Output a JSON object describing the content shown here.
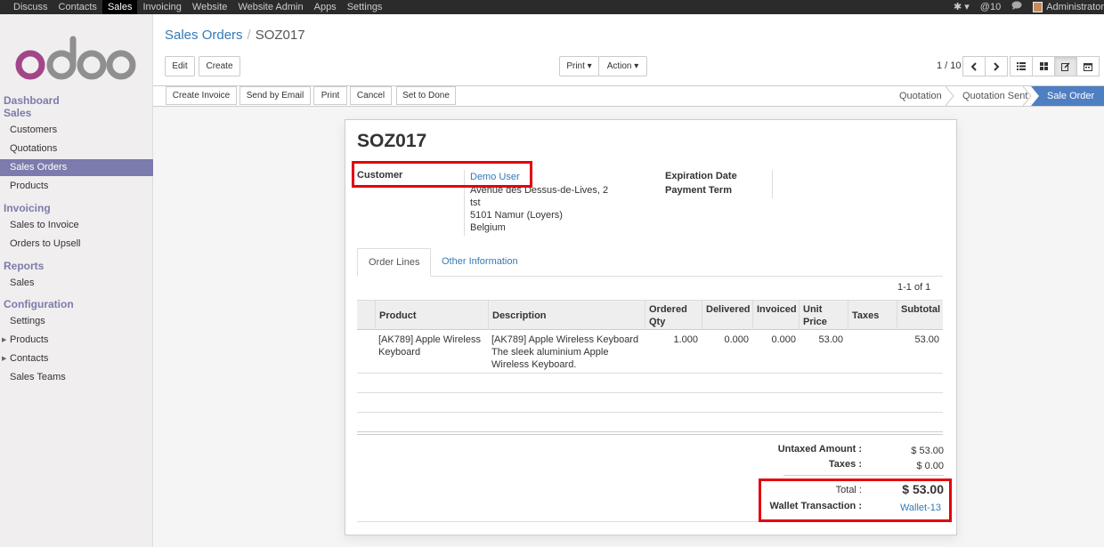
{
  "topbar": {
    "menu": [
      "Discuss",
      "Contacts",
      "Sales",
      "Invoicing",
      "Website",
      "Website Admin",
      "Apps",
      "Settings"
    ],
    "active": "Sales",
    "bug": "✱ ▾",
    "notifications": "@10",
    "chat": "💬",
    "user": "Administrator"
  },
  "sidebar": {
    "dashboard": "Dashboard",
    "sales_head": "Sales",
    "sales_items": [
      "Customers",
      "Quotations",
      "Sales Orders",
      "Products"
    ],
    "invoicing_head": "Invoicing",
    "invoicing_items": [
      "Sales to Invoice",
      "Orders to Upsell"
    ],
    "reports_head": "Reports",
    "reports_items": [
      "Sales"
    ],
    "config_head": "Configuration",
    "config_items": [
      "Settings",
      "Products",
      "Contacts",
      "Sales Teams"
    ]
  },
  "breadcrumb": {
    "parent": "Sales Orders",
    "current": "SOZ017",
    "sep": "/"
  },
  "buttons": {
    "edit": "Edit",
    "create": "Create",
    "print": "Print ▾",
    "action": "Action ▾",
    "pager": "1 / 10"
  },
  "status_buttons": [
    "Create Invoice",
    "Send by Email",
    "Print",
    "Cancel",
    "Set to Done"
  ],
  "stages": [
    "Quotation",
    "Quotation Sent",
    "Sale Order"
  ],
  "form": {
    "name": "SOZ017",
    "customer_label": "Customer",
    "customer": "Demo User",
    "address": [
      "Avenue des Dessus-de-Lives, 2",
      "tst",
      "5101 Namur (Loyers)",
      "Belgium"
    ],
    "expiration_label": "Expiration Date",
    "payment_term_label": "Payment Term"
  },
  "tabs": [
    "Order Lines",
    "Other Information"
  ],
  "table": {
    "pager": "1-1 of 1",
    "headers": [
      "Product",
      "Description",
      "Ordered Qty",
      "Delivered",
      "Invoiced",
      "Unit Price",
      "Taxes",
      "Subtotal"
    ],
    "rows": [
      {
        "product": [
          "[AK789] Apple Wireless",
          "Keyboard"
        ],
        "description": [
          "[AK789] Apple Wireless Keyboard",
          "The sleek aluminium Apple",
          "Wireless Keyboard."
        ],
        "ordered": "1.000",
        "delivered": "0.000",
        "invoiced": "0.000",
        "price": "53.00",
        "taxes": "",
        "subtotal": "53.00"
      }
    ]
  },
  "totals": {
    "untaxed_label": "Untaxed Amount :",
    "untaxed": "$ 53.00",
    "taxes_label": "Taxes :",
    "taxes": "$ 0.00",
    "total_label": "Total :",
    "total": "$ 53.00",
    "wallet_label": "Wallet Transaction :",
    "wallet": "Wallet-13"
  },
  "colors": {
    "accent": "#7c7bad",
    "link": "#337ab7",
    "highlight": "#e4000f",
    "stage_active": "#4f7fc3"
  }
}
